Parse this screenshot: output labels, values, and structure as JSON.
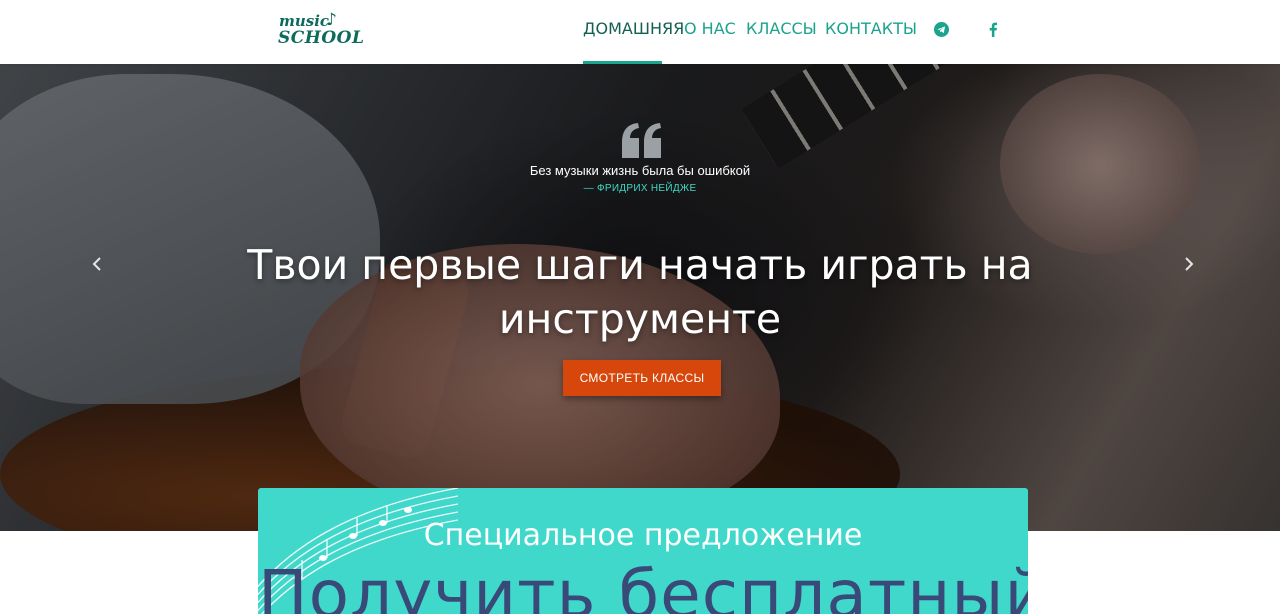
{
  "logo": {
    "line1": "music",
    "line2": "SCHOOL"
  },
  "nav": {
    "items": [
      {
        "label": "ДОМАШНЯЯ",
        "active": true
      },
      {
        "label": "О НАС",
        "active": false
      },
      {
        "label": "КЛАССЫ",
        "active": false
      },
      {
        "label": "КОНТАКТЫ",
        "active": false
      }
    ],
    "icons": [
      "telegram-icon",
      "facebook-icon"
    ]
  },
  "hero": {
    "quote": "Без музыки жизнь была бы ошибкой",
    "author": "— ФРИДРИХ НЕЙДЖЕ",
    "title": "Твои первые шаги начать играть на инструменте",
    "cta_label": "СМОТРЕТЬ КЛАССЫ"
  },
  "offer": {
    "subtitle": "Специальное предложение",
    "headline": "Получить бесплатный"
  },
  "colors": {
    "accent": "#1aa38d",
    "cta": "#d7460a",
    "offer_bg": "#40d8ca",
    "offer_text": "#3a4a78"
  }
}
